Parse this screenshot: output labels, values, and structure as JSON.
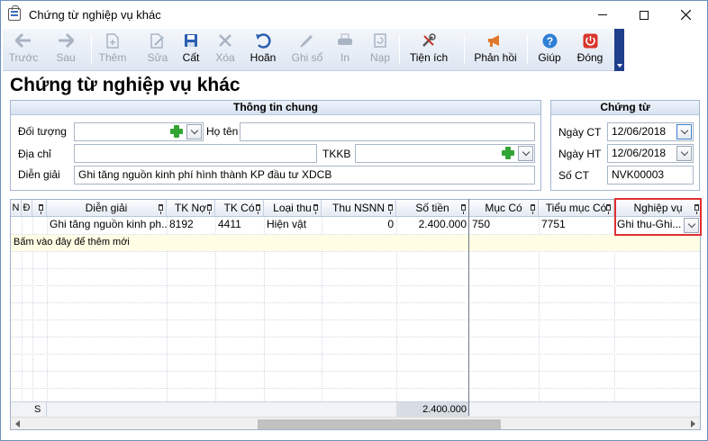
{
  "window": {
    "title": "Chứng từ nghiệp vụ khác"
  },
  "toolbar": {
    "buttons": [
      {
        "label": "Trước",
        "icon": "arrow-left-icon",
        "enabled": false
      },
      {
        "label": "Sau",
        "icon": "arrow-right-icon",
        "enabled": false
      },
      {
        "label": "Thêm",
        "icon": "add-document-icon",
        "enabled": false
      },
      {
        "label": "Sửa",
        "icon": "edit-document-icon",
        "enabled": false
      },
      {
        "label": "Cất",
        "icon": "save-icon",
        "enabled": true
      },
      {
        "label": "Xóa",
        "icon": "delete-icon",
        "enabled": false
      },
      {
        "label": "Hoãn",
        "icon": "undo-icon",
        "enabled": true
      },
      {
        "label": "Ghi sổ",
        "icon": "pencil-icon",
        "enabled": false
      },
      {
        "label": "In",
        "icon": "print-icon",
        "enabled": false
      },
      {
        "label": "Nạp",
        "icon": "reload-icon",
        "enabled": false
      },
      {
        "label": "Tiện ích",
        "icon": "tools-icon",
        "enabled": true
      },
      {
        "label": "Phản hồi",
        "icon": "megaphone-icon",
        "enabled": true
      },
      {
        "label": "Giúp",
        "icon": "help-icon",
        "enabled": true
      },
      {
        "label": "Đóng",
        "icon": "power-icon",
        "enabled": true
      }
    ]
  },
  "page": {
    "heading": "Chứng từ nghiệp vụ khác"
  },
  "general": {
    "header": "Thông tin chung",
    "doi_tuong_label": "Đối tượng",
    "doi_tuong_value": "",
    "ho_ten_label": "Họ tên",
    "ho_ten_value": "",
    "dia_chi_label": "Địa chỉ",
    "dia_chi_value": "",
    "tkkb_label": "TKKB",
    "tkkb_value": "",
    "dien_giai_label": "Diễn giải",
    "dien_giai_value": "Ghi tăng nguồn kinh phí hình thành KP đầu tư XDCB"
  },
  "voucher": {
    "header": "Chứng từ",
    "ngay_ct_label": "Ngày CT",
    "ngay_ct_value": "12/06/2018",
    "ngay_ht_label": "Ngày HT",
    "ngay_ht_value": "12/06/2018",
    "so_ct_label": "Số CT",
    "so_ct_value": "NVK00003"
  },
  "grid": {
    "columns": [
      "N",
      "Đ",
      "Diễn giải",
      "TK Nợ",
      "TK Có",
      "Loại thu",
      "Thu NSNN",
      "Số tiền",
      "Mục Có",
      "Tiểu mục Có",
      "Nghiệp vụ"
    ],
    "rows": [
      {
        "dien_giai": "Ghi tăng nguồn kinh ph...",
        "tk_no": "8192",
        "tk_co": "4411",
        "loai_thu": "Hiện vật",
        "thu_nsnn": "0",
        "so_tien": "2.400.000",
        "muc_co": "750",
        "tieu_muc_co": "7751",
        "nghiep_vu": "Ghi thu-Ghi..."
      }
    ],
    "add_row_text": "Bấm vào đây để thêm mới",
    "footer_label": "S",
    "footer_total": "2.400.000"
  }
}
